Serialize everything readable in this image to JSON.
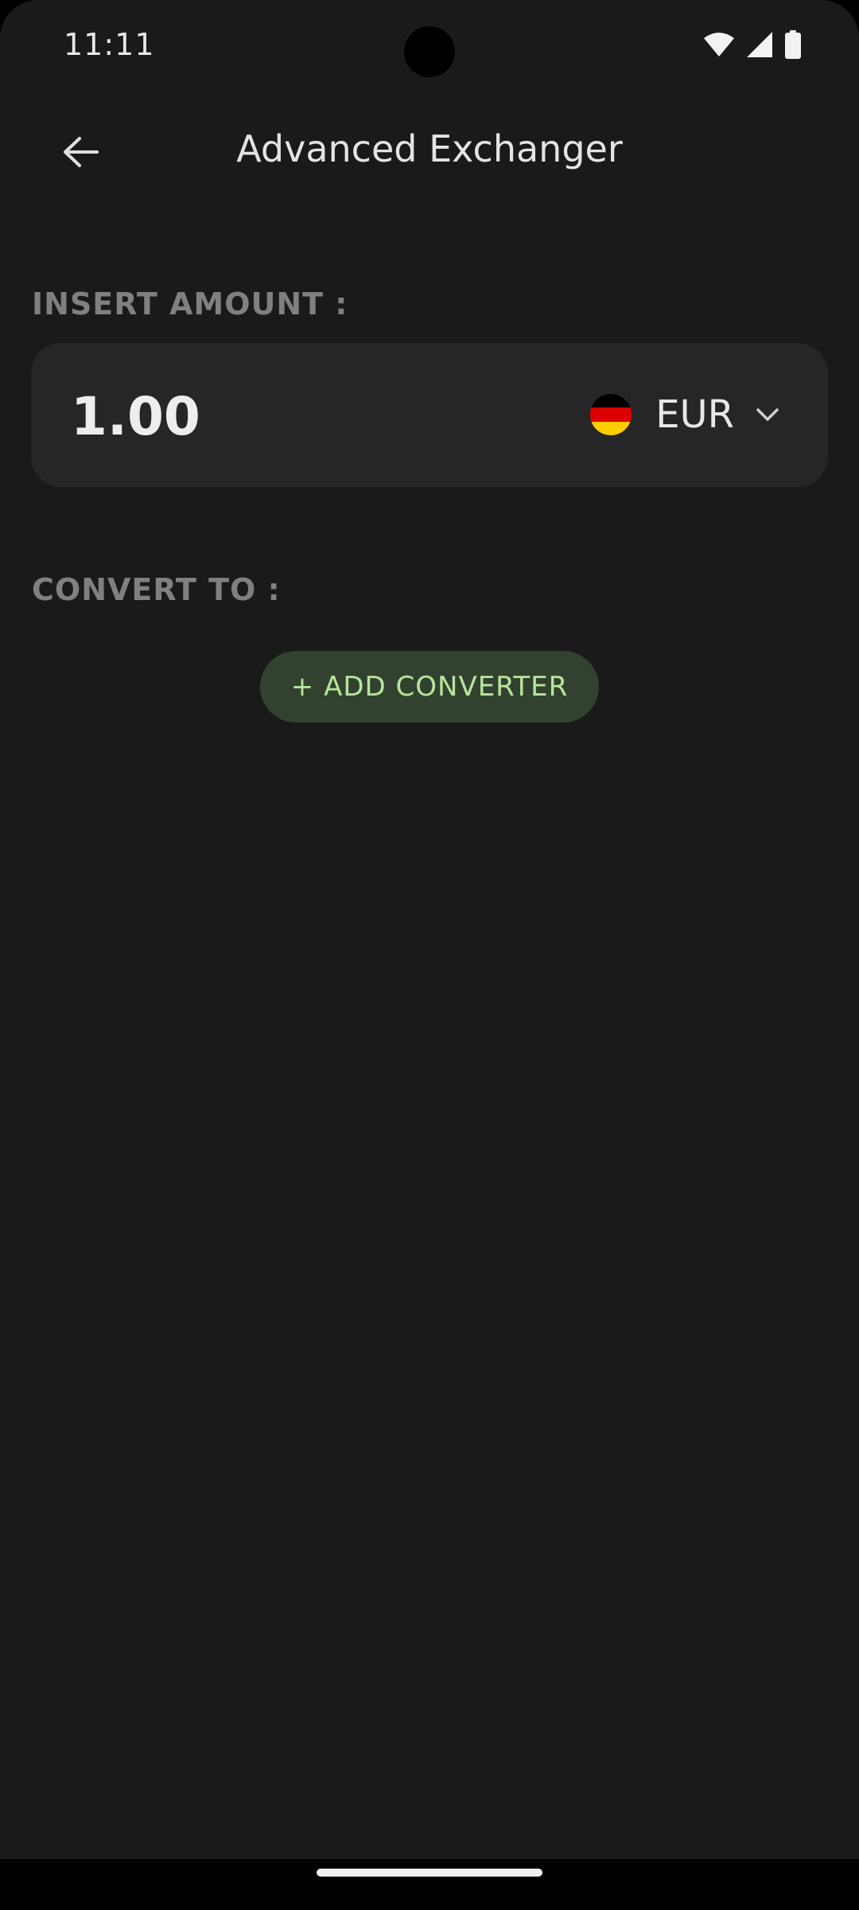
{
  "status_bar": {
    "time": "11:11",
    "icons": [
      "wifi-icon",
      "cellular-signal-icon",
      "battery-icon"
    ]
  },
  "app_bar": {
    "back_icon": "arrow-left-icon",
    "title": "Advanced Exchanger"
  },
  "amount_section": {
    "label": "INSERT AMOUNT :",
    "value": "1.00",
    "currency": {
      "code": "EUR",
      "flag_icon": "germany-flag-icon",
      "flag_colors": [
        "#000000",
        "#dd0000",
        "#ffce00"
      ],
      "dropdown_icon": "chevron-down-icon"
    }
  },
  "convert_section": {
    "label": "CONVERT TO :",
    "add_button_label": "+ ADD CONVERTER"
  },
  "colors": {
    "background": "#1a1a1a",
    "card": "#262527",
    "label": "#808080",
    "accent_text": "#b6e69a",
    "accent_bg": "#334230"
  }
}
